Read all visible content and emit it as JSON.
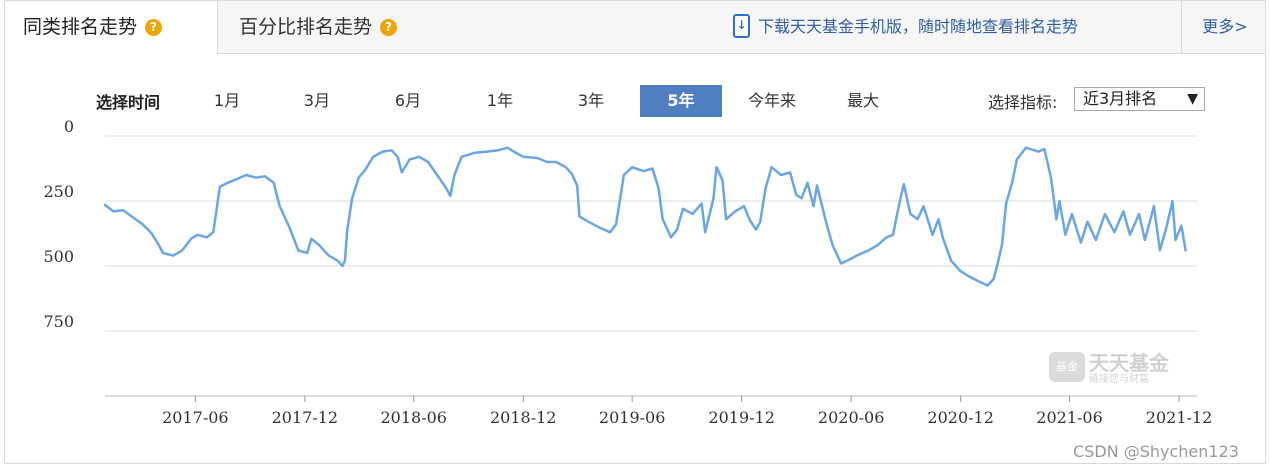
{
  "tabs": [
    {
      "label": "同类排名走势",
      "active": true
    },
    {
      "label": "百分比排名走势",
      "active": false
    }
  ],
  "download_text": "下载天天基金手机版，随时随地查看排名走势",
  "more_label": "更多>",
  "range": {
    "label": "选择时间",
    "options": [
      "1月",
      "3月",
      "6月",
      "1年",
      "3年",
      "5年",
      "今年来",
      "最大"
    ],
    "selected": "5年"
  },
  "indicator": {
    "label": "选择指标:",
    "selected": "近3月排名"
  },
  "watermark": {
    "logo_text": "基金",
    "title": "天天基金",
    "subtitle": "链接您与财富"
  },
  "credit": "CSDN @Shychen123",
  "colors": {
    "line": "#6aa6e4",
    "active_button": "#4f7ec1",
    "link": "#2f5fa8",
    "grid": "#dddddd",
    "help_icon": "#f0a30a"
  },
  "chart_data": {
    "type": "line",
    "title": "",
    "xlabel": "",
    "ylabel": "",
    "y_inverted": true,
    "ylim": [
      0,
      1000
    ],
    "yticks": [
      0,
      250,
      500,
      750
    ],
    "xticks": [
      "2017-06",
      "2017-12",
      "2018-06",
      "2018-12",
      "2019-06",
      "2019-12",
      "2020-06",
      "2020-12",
      "2021-06",
      "2021-12"
    ],
    "xlim": [
      "2017-01-01",
      "2021-12-31"
    ],
    "grid": true,
    "series": [
      {
        "values": [
          [
            "2017-01-01",
            265
          ],
          [
            "2017-01-15",
            290
          ],
          [
            "2017-01-31",
            285
          ],
          [
            "2017-02-15",
            310
          ],
          [
            "2017-03-05",
            340
          ],
          [
            "2017-03-20",
            375
          ],
          [
            "2017-04-01",
            420
          ],
          [
            "2017-04-08",
            450
          ],
          [
            "2017-04-25",
            460
          ],
          [
            "2017-05-10",
            440
          ],
          [
            "2017-05-25",
            395
          ],
          [
            "2017-06-05",
            380
          ],
          [
            "2017-06-20",
            390
          ],
          [
            "2017-07-01",
            370
          ],
          [
            "2017-07-06",
            290
          ],
          [
            "2017-07-12",
            195
          ],
          [
            "2017-07-25",
            180
          ],
          [
            "2017-08-10",
            165
          ],
          [
            "2017-08-25",
            150
          ],
          [
            "2017-09-10",
            160
          ],
          [
            "2017-09-25",
            155
          ],
          [
            "2017-10-10",
            180
          ],
          [
            "2017-10-20",
            270
          ],
          [
            "2017-11-05",
            350
          ],
          [
            "2017-11-20",
            440
          ],
          [
            "2017-12-05",
            450
          ],
          [
            "2017-12-12",
            395
          ],
          [
            "2017-12-25",
            420
          ],
          [
            "2018-01-10",
            460
          ],
          [
            "2018-01-25",
            480
          ],
          [
            "2018-02-02",
            500
          ],
          [
            "2018-02-06",
            480
          ],
          [
            "2018-02-10",
            360
          ],
          [
            "2018-02-18",
            240
          ],
          [
            "2018-03-01",
            160
          ],
          [
            "2018-03-12",
            130
          ],
          [
            "2018-03-25",
            80
          ],
          [
            "2018-04-10",
            60
          ],
          [
            "2018-04-25",
            55
          ],
          [
            "2018-05-05",
            80
          ],
          [
            "2018-05-12",
            140
          ],
          [
            "2018-05-25",
            90
          ],
          [
            "2018-06-10",
            80
          ],
          [
            "2018-06-25",
            100
          ],
          [
            "2018-07-10",
            150
          ],
          [
            "2018-07-25",
            200
          ],
          [
            "2018-08-01",
            230
          ],
          [
            "2018-08-08",
            150
          ],
          [
            "2018-08-20",
            80
          ],
          [
            "2018-09-10",
            65
          ],
          [
            "2018-10-01",
            60
          ],
          [
            "2018-10-20",
            55
          ],
          [
            "2018-11-05",
            45
          ],
          [
            "2018-11-15",
            60
          ],
          [
            "2018-12-01",
            80
          ],
          [
            "2018-12-25",
            85
          ],
          [
            "2019-01-10",
            100
          ],
          [
            "2019-01-25",
            100
          ],
          [
            "2019-02-10",
            120
          ],
          [
            "2019-02-20",
            145
          ],
          [
            "2019-03-01",
            190
          ],
          [
            "2019-03-05",
            310
          ],
          [
            "2019-03-20",
            330
          ],
          [
            "2019-04-10",
            355
          ],
          [
            "2019-04-25",
            370
          ],
          [
            "2019-05-05",
            340
          ],
          [
            "2019-05-12",
            240
          ],
          [
            "2019-05-18",
            150
          ],
          [
            "2019-06-01",
            120
          ],
          [
            "2019-06-20",
            135
          ],
          [
            "2019-07-05",
            125
          ],
          [
            "2019-07-15",
            200
          ],
          [
            "2019-07-22",
            320
          ],
          [
            "2019-08-05",
            390
          ],
          [
            "2019-08-15",
            360
          ],
          [
            "2019-08-25",
            280
          ],
          [
            "2019-09-10",
            300
          ],
          [
            "2019-09-25",
            260
          ],
          [
            "2019-10-01",
            370
          ],
          [
            "2019-10-15",
            240
          ],
          [
            "2019-10-20",
            120
          ],
          [
            "2019-10-30",
            170
          ],
          [
            "2019-11-05",
            320
          ],
          [
            "2019-11-20",
            290
          ],
          [
            "2019-12-05",
            270
          ],
          [
            "2019-12-15",
            325
          ],
          [
            "2019-12-25",
            360
          ],
          [
            "2020-01-01",
            330
          ],
          [
            "2020-01-10",
            200
          ],
          [
            "2020-01-20",
            120
          ],
          [
            "2020-02-05",
            150
          ],
          [
            "2020-02-20",
            140
          ],
          [
            "2020-03-01",
            225
          ],
          [
            "2020-03-10",
            240
          ],
          [
            "2020-03-20",
            180
          ],
          [
            "2020-03-30",
            270
          ],
          [
            "2020-04-05",
            190
          ],
          [
            "2020-04-20",
            330
          ],
          [
            "2020-05-01",
            420
          ],
          [
            "2020-05-15",
            490
          ],
          [
            "2020-05-25",
            480
          ],
          [
            "2020-06-10",
            460
          ],
          [
            "2020-06-30",
            440
          ],
          [
            "2020-07-15",
            420
          ],
          [
            "2020-07-30",
            390
          ],
          [
            "2020-08-10",
            380
          ],
          [
            "2020-08-20",
            265
          ],
          [
            "2020-08-28",
            185
          ],
          [
            "2020-09-08",
            300
          ],
          [
            "2020-09-20",
            320
          ],
          [
            "2020-09-30",
            270
          ],
          [
            "2020-10-15",
            380
          ],
          [
            "2020-10-25",
            320
          ],
          [
            "2020-11-01",
            390
          ],
          [
            "2020-11-15",
            480
          ],
          [
            "2020-12-01",
            520
          ],
          [
            "2020-12-15",
            540
          ],
          [
            "2021-01-01",
            560
          ],
          [
            "2021-01-15",
            575
          ],
          [
            "2021-01-25",
            550
          ],
          [
            "2021-02-01",
            490
          ],
          [
            "2021-02-08",
            420
          ],
          [
            "2021-02-15",
            260
          ],
          [
            "2021-02-25",
            180
          ],
          [
            "2021-03-05",
            90
          ],
          [
            "2021-03-20",
            45
          ],
          [
            "2021-04-10",
            60
          ],
          [
            "2021-04-20",
            50
          ],
          [
            "2021-05-01",
            160
          ],
          [
            "2021-05-10",
            320
          ],
          [
            "2021-05-15",
            250
          ],
          [
            "2021-05-25",
            380
          ],
          [
            "2021-06-05",
            300
          ],
          [
            "2021-06-20",
            410
          ],
          [
            "2021-07-01",
            330
          ],
          [
            "2021-07-15",
            400
          ],
          [
            "2021-07-30",
            300
          ],
          [
            "2021-08-15",
            370
          ],
          [
            "2021-08-30",
            290
          ],
          [
            "2021-09-10",
            380
          ],
          [
            "2021-09-25",
            300
          ],
          [
            "2021-10-05",
            400
          ],
          [
            "2021-10-20",
            270
          ],
          [
            "2021-10-30",
            440
          ],
          [
            "2021-11-10",
            350
          ],
          [
            "2021-11-20",
            250
          ],
          [
            "2021-11-25",
            400
          ],
          [
            "2021-12-05",
            345
          ],
          [
            "2021-12-12",
            440
          ]
        ]
      }
    ]
  }
}
